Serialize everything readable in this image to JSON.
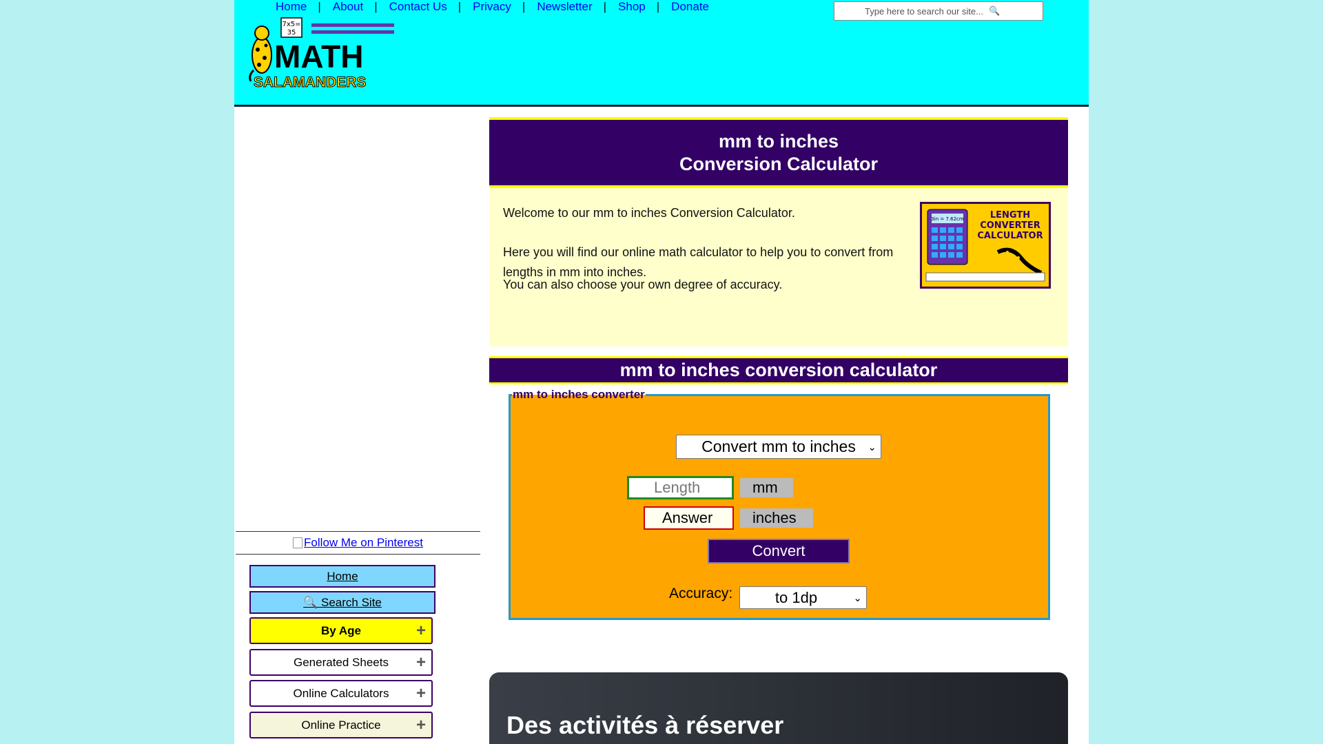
{
  "nav": {
    "links": [
      "Home",
      "About",
      "Contact Us",
      "Privacy",
      "Newsletter",
      "Shop",
      "Donate"
    ],
    "separator": "|"
  },
  "search": {
    "placeholder": "Type here to search our site...",
    "icon": "magnifier-icon"
  },
  "logo": {
    "top_text": "MATH",
    "bottom_text": "SALAMANDERS",
    "sign_text_1": "7x5=",
    "sign_text_2": "35"
  },
  "sidebar": {
    "pinterest_label": "Follow Me on Pinterest",
    "home_label": "Home",
    "search_label": "🔍 Search Site",
    "menus": [
      {
        "label": "By Age",
        "color": "#ffff00"
      },
      {
        "label": "Generated Sheets",
        "color": "#ffffff"
      },
      {
        "label": "Online Calculators",
        "color": "#ffffff"
      },
      {
        "label": "Online Practice",
        "color": "#f5f5dc"
      }
    ],
    "expand_symbol": "+"
  },
  "main": {
    "title_line1": "mm to inches",
    "title_line2": "Conversion Calculator",
    "intro_p1": "Welcome to our mm to inches Conversion Calculator.",
    "intro_p2": "Here you will find our online math calculator to help you to convert from lengths in mm into inches.",
    "intro_p3": "You can also choose your own degree of accuracy.",
    "image": {
      "line1": "LENGTH",
      "line2": "CONVERTER",
      "line3": "CALCULATOR",
      "screen_text": "3in = 7.62cm"
    },
    "section_title": "mm to inches conversion calculator"
  },
  "converter": {
    "legend": "mm to inches converter",
    "mode_selected": "Convert mm to inches",
    "length_placeholder": "Length",
    "length_unit": "mm",
    "answer_placeholder": "Answer",
    "answer_unit": "inches",
    "convert_label": "Convert",
    "accuracy_label": "Accuracy:",
    "accuracy_selected": "to 1dp"
  },
  "ad": {
    "headline": "Des activités à réserver"
  },
  "colors": {
    "page_bg": "#b7f1f1",
    "header_bg": "#00ffff",
    "banner": "#330066",
    "banner_border": "#ffff00",
    "intro_bg": "#ffffcc",
    "converter_bg": "#ffa500",
    "link": "#0000ee"
  }
}
